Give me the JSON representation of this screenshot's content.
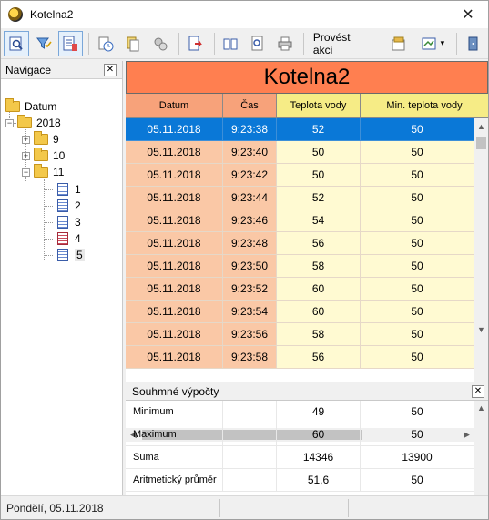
{
  "window": {
    "title": "Kotelna2",
    "close_glyph": "✕"
  },
  "toolbar": {
    "buttons": [
      {
        "icon": "preview-icon",
        "active": true
      },
      {
        "icon": "filter-icon",
        "active": false
      },
      {
        "icon": "table-report-icon",
        "active": true
      },
      {
        "icon": "clock-icon",
        "active": false
      },
      {
        "icon": "copy-icon",
        "active": false
      },
      {
        "icon": "gears-icon",
        "active": false
      },
      {
        "icon": "export-icon",
        "active": false
      },
      {
        "icon": "book-icon",
        "active": false
      },
      {
        "icon": "print-preview-icon",
        "active": false
      },
      {
        "icon": "printer-icon",
        "active": false
      }
    ],
    "action_label": "Provést akci",
    "right_icons": [
      "settings-icon",
      "chart-dropdown-icon",
      "exit-icon"
    ],
    "dropdown_glyph": "▾"
  },
  "navigation": {
    "header": "Navigace",
    "close_glyph": "✕",
    "tree": {
      "root": "Datum",
      "year": "2018",
      "months": [
        "9",
        "10",
        "11"
      ],
      "days": [
        "1",
        "2",
        "3",
        "4",
        "5"
      ],
      "selected_day": "5",
      "expanded_glyph": "−",
      "collapsed_glyph": "+"
    }
  },
  "grid": {
    "title": "Kotelna2",
    "columns": [
      "Datum",
      "Čas",
      "Teplota vody",
      "Min. teplota vody"
    ],
    "column_colors": [
      "#fac8a6",
      "#fac8a6",
      "#fffad2",
      "#fffad2"
    ],
    "header_colors": [
      "#f7a27a",
      "#f7a27a",
      "#f6ec86",
      "#f6ec86"
    ],
    "selected_row": 0,
    "rows": [
      [
        "05.11.2018",
        "9:23:38",
        "52",
        "50"
      ],
      [
        "05.11.2018",
        "9:23:40",
        "50",
        "50"
      ],
      [
        "05.11.2018",
        "9:23:42",
        "50",
        "50"
      ],
      [
        "05.11.2018",
        "9:23:44",
        "52",
        "50"
      ],
      [
        "05.11.2018",
        "9:23:46",
        "54",
        "50"
      ],
      [
        "05.11.2018",
        "9:23:48",
        "56",
        "50"
      ],
      [
        "05.11.2018",
        "9:23:50",
        "58",
        "50"
      ],
      [
        "05.11.2018",
        "9:23:52",
        "60",
        "50"
      ],
      [
        "05.11.2018",
        "9:23:54",
        "60",
        "50"
      ],
      [
        "05.11.2018",
        "9:23:56",
        "58",
        "50"
      ],
      [
        "05.11.2018",
        "9:23:58",
        "56",
        "50"
      ]
    ],
    "scroll_up_glyph": "▲",
    "scroll_down_glyph": "▼",
    "scroll_left_glyph": "◀",
    "scroll_right_glyph": "▶"
  },
  "summary": {
    "header": "Souhmné výpočty",
    "close_glyph": "✕",
    "rows": [
      [
        "Minimum",
        "",
        "49",
        "50"
      ],
      [
        "Maximum",
        "",
        "60",
        "50"
      ],
      [
        "Suma",
        "",
        "14346",
        "13900"
      ],
      [
        "Aritmetický průměr",
        "",
        "51,6",
        "50"
      ]
    ]
  },
  "status": {
    "text": "Pondělí, 05.11.2018"
  }
}
